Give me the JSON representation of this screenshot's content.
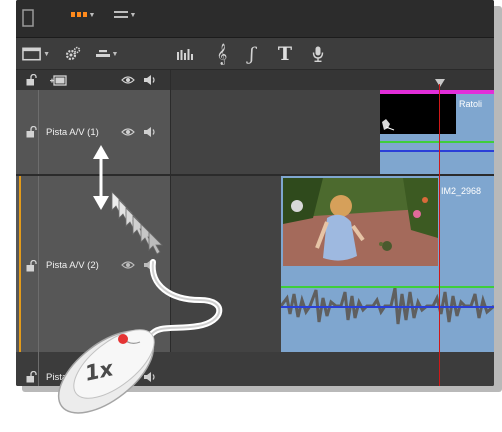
{
  "tracks": [
    {
      "label": "Pista A/V (1)"
    },
    {
      "label": "Pista A/V (2)"
    },
    {
      "label": "Pista"
    }
  ],
  "clips": {
    "track1_title": "Ratoli",
    "track2_video": "IM2_2968"
  },
  "callout": {
    "click_count": "1x"
  },
  "colors": {
    "track_selected_accent": "#e39b1a",
    "playhead": "#d01818",
    "clip_fill": "#7fa6cf",
    "clip_top_bar": "#e22ed9",
    "audio_line_green": "#3fce3a",
    "audio_line_blue": "#2a3fd8"
  },
  "icons": [
    "lock-icon",
    "eye-icon",
    "speaker-icon",
    "film-icon",
    "gear-icon",
    "track-height-icon",
    "equalizer-icon",
    "music-note-icon",
    "title-icon",
    "microphone-icon",
    "mouse-icon",
    "vertical-arrows-icon"
  ]
}
